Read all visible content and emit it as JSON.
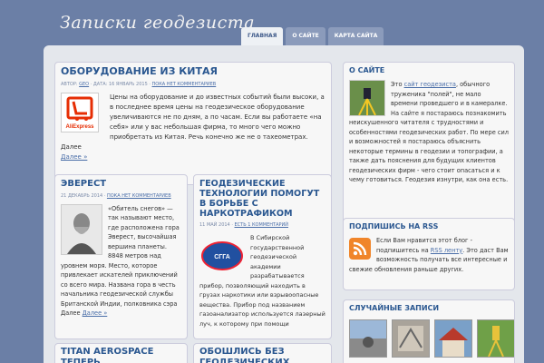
{
  "site": {
    "title": "Записки геодезиста"
  },
  "nav": [
    {
      "label": "Главная",
      "active": true
    },
    {
      "label": "О сайте",
      "active": false
    },
    {
      "label": "Карта сайта",
      "active": false
    }
  ],
  "posts": [
    {
      "title": "Оборудование из Китая",
      "meta_prefix": "Автор:",
      "author": "Geo",
      "date": "· Дата: 16 январь 2015 ·",
      "comments": "Пока нет комментариев",
      "text": "Цены на оборудование и до известных событий были высоки, а в последнее время цены на геодезическое оборудование увеличиваются не по дням, а по часам. Если вы работаете «на себя» или у вас небольшая фирма, то много чего можно приобретать из Китая. Речь конечно же не о тахеометрах. Далее",
      "more": "Далее »"
    },
    {
      "title": "Эверест",
      "date": "21 декабрь 2014 ·",
      "comments": "Пока нет комментариев",
      "text": "«Обитель снегов» — так называют место, где расположена гора Эверест, высочайшая вершина планеты. 8848 метров над уровнем моря. Место, которое привлекает искателей приключений со всего мира. Названа гора в честь начальника геодезической службы Британской Индии, полковника сэра Далее",
      "more": "Далее »"
    },
    {
      "title": "Геодезические технологии помогут в борьбе с наркотрафиком",
      "date": "11 май 2014 ·",
      "comments": "Есть 1 комментарий",
      "text": "В Сибирской государственной геодезической академии разрабатывается прибор, позволяющий находить в грузах наркотики или взрывоопасные вещества. Прибор под названием газоанализатор используется лазерный луч, к которому при помощи"
    },
    {
      "title": "Titan Aerospace теперь принадлежит"
    },
    {
      "title": "Обошлись без геодезических работ"
    }
  ],
  "sidebar": {
    "about": {
      "title": "О сайте",
      "pre": "Это",
      "link": "сайт геодезиста",
      "text": ", обычного труженика \"полей\", не мало времени проведшего и в камералке. На сайте я постараюсь познакомить неискушенного читателя с трудностями и особенностями геодезических работ. По мере сил и возможностей я постараюсь объяснить некоторые термины в геодезии и топографии, а также дать пояснения для будущих клиентов геодезических фирм - чего стоит опасаться и к чему готовиться. Геодезия изнутри, как она есть."
    },
    "rss": {
      "title": "Подпишись на RSS",
      "text1": "Если Вам нравится этот блог - подпишитесь на",
      "link": "RSS ленту",
      "text2": ". Это даст Вам возможность получать все интересные и свежие обновления раньше других."
    },
    "random": {
      "title": "Случайные записи"
    }
  },
  "icons": {
    "rss": "rss-icon",
    "logo": "aliexpress-logo"
  },
  "colors": {
    "background": "#6b7fa6",
    "title": "#2a5790",
    "link": "#4a6ea8",
    "aliexpress": "#e62e04",
    "rss": "#f0852a"
  }
}
